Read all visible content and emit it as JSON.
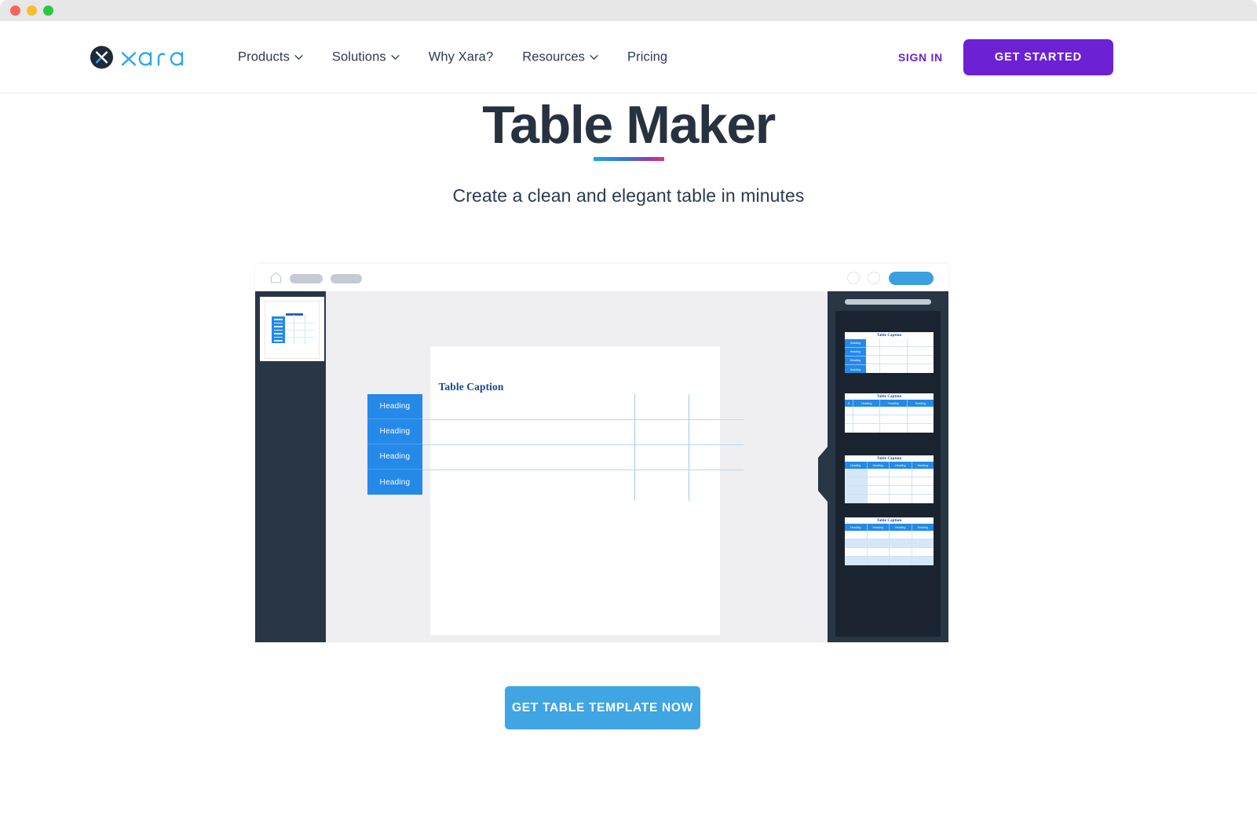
{
  "browser": {
    "dots": [
      "close-red",
      "minimize-yellow",
      "maximize-green"
    ]
  },
  "header": {
    "logo_text": "xara",
    "logo_icon": "xara-x-mark-icon",
    "nav": [
      {
        "label": "Products",
        "has_caret": true
      },
      {
        "label": "Solutions",
        "has_caret": true
      },
      {
        "label": "Why Xara?",
        "has_caret": false
      },
      {
        "label": "Resources",
        "has_caret": true
      },
      {
        "label": "Pricing",
        "has_caret": false
      }
    ],
    "sign_in_label": "SIGN IN",
    "get_started_label": "GET STARTED",
    "accent_purple": "#6c21d4"
  },
  "hero": {
    "title": "Table Maker",
    "subtitle": "Create a clean and elegant table in minutes",
    "rule_gradient_from": "#1ba4e8",
    "rule_gradient_to": "#e0366f"
  },
  "mockup": {
    "toolbar": {
      "home_icon": "home-icon",
      "pill_1": "toolbar-pill",
      "pill_2": "toolbar-pill",
      "circle_1": "toolbar-circle-button",
      "circle_2": "toolbar-circle-button",
      "primary_pill": "toolbar-primary-button",
      "primary_color": "#3b9fe0"
    },
    "sidebar": {
      "bg": "#283645",
      "thumbnails": [
        {
          "name": "page-thumbnail-1",
          "selected": true
        }
      ]
    },
    "canvas": {
      "bg": "#efeef1",
      "page_bg": "#ffffff",
      "table": {
        "caption": "Table Caption",
        "caption_color": "#19488f",
        "header_cells": [
          "Heading",
          "Heading",
          "Heading",
          "Heading"
        ],
        "header_bg": "#2489e8",
        "grid_color": "#b9d7f2",
        "columns": 3,
        "rows": 4
      }
    },
    "right_panel": {
      "bg": "#283645",
      "inner_bg": "#1a2430",
      "handle": "drag-handle",
      "templates": [
        {
          "name": "template-left-header-column",
          "caption": "Table Caption",
          "side_headings": [
            "Heading",
            "Heading",
            "Heading",
            "Heading"
          ],
          "top_headings": [],
          "rows": 4,
          "cols": 3,
          "striped": false
        },
        {
          "name": "template-numbered-header-row",
          "caption": "Table Caption",
          "side_headings": [],
          "top_headings": [
            "#",
            "Heading",
            "Heading",
            "Heading"
          ],
          "rows": 3,
          "cols": 4,
          "striped": false
        },
        {
          "name": "template-tinted-first-column",
          "caption": "Table Caption",
          "side_headings": [],
          "top_headings": [
            "Heading",
            "Heading",
            "Heading",
            "Heading"
          ],
          "rows": 4,
          "cols": 4,
          "striped": false,
          "first_col_tinted": true
        },
        {
          "name": "template-zebra-striped",
          "caption": "Table Caption",
          "side_headings": [],
          "top_headings": [
            "Heading",
            "Heading",
            "Heading",
            "Heading"
          ],
          "rows": 4,
          "cols": 4,
          "striped": true
        }
      ]
    }
  },
  "cta": {
    "label": "GET TABLE TEMPLATE NOW",
    "color": "#3fa5e3"
  }
}
